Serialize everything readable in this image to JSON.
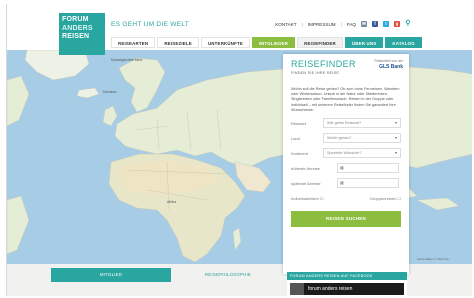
{
  "header": {
    "logo_lines": [
      "FORUM",
      "ANDERS",
      "REISEN"
    ],
    "tagline": "ES GEHT UM DIE WELT",
    "utility": {
      "kontakt": "KONTAKT",
      "impressum": "IMPRESSUM",
      "faq": "FAQ",
      "sep": "|"
    },
    "social_icons": [
      "mail-icon",
      "facebook-icon",
      "twitter-icon",
      "googleplus-icon",
      "search-icon"
    ],
    "colors": {
      "teal": "#2aa6a0",
      "green": "#8dbd3e"
    }
  },
  "nav": {
    "items": [
      {
        "label": "REISEARTEN",
        "style": "plain"
      },
      {
        "label": "REISEZIELE",
        "style": "plain"
      },
      {
        "label": "UNTERKÜNFTE",
        "style": "plain"
      },
      {
        "label": "MITGLIEDER",
        "style": "green"
      },
      {
        "label": "REISEFINDER",
        "style": "light"
      },
      {
        "label": "ÜBER UNS",
        "style": "teal"
      },
      {
        "label": "KATALOG",
        "style": "teal"
      }
    ]
  },
  "map": {
    "labels": [
      "Norwegisches Meer",
      "Nordsee",
      "Afrika"
    ],
    "attribution": "Kartendaten © 2013 Go..."
  },
  "finder": {
    "title": "REISEFINDER",
    "subtitle": "FINDEN SIE IHRE REISE",
    "sponsor_prefix": "Präsentiert von der",
    "sponsor": "GLS Bank",
    "intro": "Wohin soll die Reise gehen? Ob zum ohne Fernreisen, Wandern oder Wintersaison. Urlaub in der Natur oder Städtereisen, Singlereisen oder Familienurlaub. Reisen in der Gruppe oder individuell – mit unserem Reisefinder finden Sie garantiert Ihre Wunschreise.",
    "rows": [
      {
        "label": "Reiseart",
        "value": "Wie gehts Reiseart?"
      },
      {
        "label": "Land",
        "value": "Wohin genau?"
      },
      {
        "label": "Kontinent",
        "value": "Spezielle Wünsche?"
      }
    ],
    "date_from_label": "früheste Anreise",
    "date_to_label": "späteste Abreise",
    "individual_label": "Individualreisen",
    "group_label": "Gruppenreisen",
    "button": "REISEN SUCHEN"
  },
  "bottom": {
    "tab_members": "MITGLIED",
    "tab_philosophy": "REISEPHILOSOPHIE",
    "fb_header": "FORUM ANDERS REISEN AUF FACEBOOK",
    "fb_name": "forum anders reisen"
  }
}
